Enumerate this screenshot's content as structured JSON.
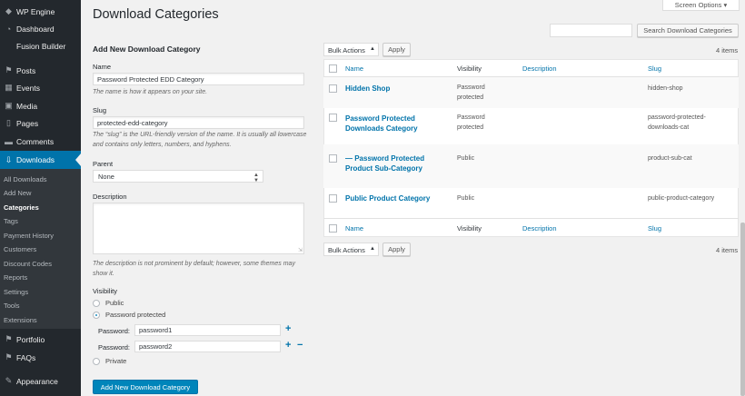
{
  "sidebar": {
    "top_items": [
      {
        "label": "WP Engine",
        "icon": "wp-engine-icon",
        "glyph": "◆"
      },
      {
        "label": "Dashboard",
        "icon": "dashboard-icon",
        "glyph": "◔"
      },
      {
        "label": "Fusion Builder",
        "icon": "",
        "glyph": ""
      }
    ],
    "items": [
      {
        "label": "Posts",
        "icon": "pin-icon",
        "glyph": "⚑"
      },
      {
        "label": "Events",
        "icon": "calendar-icon",
        "glyph": "▦"
      },
      {
        "label": "Media",
        "icon": "media-icon",
        "glyph": "▣"
      },
      {
        "label": "Pages",
        "icon": "page-icon",
        "glyph": "▯"
      },
      {
        "label": "Comments",
        "icon": "comment-icon",
        "glyph": "▬"
      },
      {
        "label": "Downloads",
        "icon": "download-icon",
        "glyph": "⇩"
      }
    ],
    "submenu": [
      "All Downloads",
      "Add New",
      "Categories",
      "Tags",
      "Payment History",
      "Customers",
      "Discount Codes",
      "Reports",
      "Settings",
      "Tools",
      "Extensions"
    ],
    "current_submenu": "Categories",
    "bottom_items": [
      {
        "label": "Portfolio",
        "icon": "pin-icon",
        "glyph": "⚑"
      },
      {
        "label": "FAQs",
        "icon": "pin-icon",
        "glyph": "⚑"
      },
      {
        "label": "Appearance",
        "icon": "brush-icon",
        "glyph": "✎"
      }
    ]
  },
  "header": {
    "title": "Download Categories",
    "screen_options": "Screen Options ▾"
  },
  "form": {
    "heading": "Add New Download Category",
    "name_label": "Name",
    "name_value": "Password Protected EDD Category",
    "name_help": "The name is how it appears on your site.",
    "slug_label": "Slug",
    "slug_value": "protected-edd-category",
    "slug_help": "The “slug” is the URL-friendly version of the name. It is usually all lowercase and contains only letters, numbers, and hyphens.",
    "parent_label": "Parent",
    "parent_value": "None",
    "description_label": "Description",
    "description_help": "The description is not prominent by default; however, some themes may show it.",
    "visibility_label": "Visibility",
    "visibility_options": [
      "Public",
      "Password protected",
      "Private"
    ],
    "visibility_selected": "Password protected",
    "password_label": "Password:",
    "passwords": [
      "password1",
      "password2"
    ],
    "submit_label": "Add New Download Category"
  },
  "search": {
    "button_label": "Search Download Categories",
    "value": ""
  },
  "table": {
    "bulk_actions_label": "Bulk Actions",
    "apply_label": "Apply",
    "count_text": "4 items",
    "columns": [
      "Name",
      "Visibility",
      "Description",
      "Slug"
    ],
    "rows": [
      {
        "name": "Hidden Shop",
        "visibility": "Password protected",
        "description": "",
        "slug": "hidden-shop"
      },
      {
        "name": "Password Protected Downloads Category",
        "visibility": "Password protected",
        "description": "",
        "slug": "password-protected-downloads-cat"
      },
      {
        "name": "— Password Protected Product Sub-Category",
        "visibility": "Public",
        "description": "",
        "slug": "product-sub-cat"
      },
      {
        "name": "Public Product Category",
        "visibility": "Public",
        "description": "",
        "slug": "public-product-category"
      }
    ]
  },
  "colors": {
    "sidebar_bg": "#23282d",
    "accent": "#0073aa",
    "primary_button": "#0085ba"
  }
}
